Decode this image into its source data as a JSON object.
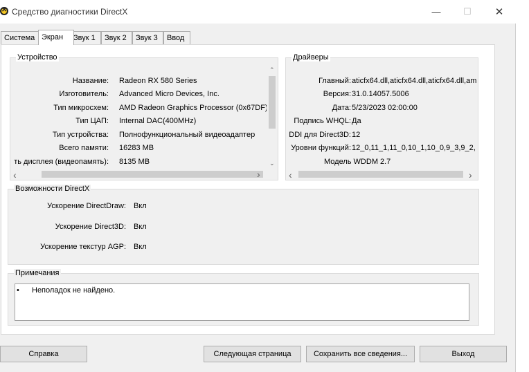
{
  "window": {
    "title": "Средство диагностики DirectX",
    "minimize": "—",
    "maximize": "☐",
    "close": "✕"
  },
  "tabs": [
    "Система",
    "Экран",
    "Звук 1",
    "Звук 2",
    "Звук 3",
    "Ввод"
  ],
  "active_tab": "Экран",
  "device": {
    "title": "Устройство",
    "rows": [
      {
        "label": "Название:",
        "value": "Radeon RX 580 Series"
      },
      {
        "label": "Изготовитель:",
        "value": "Advanced Micro Devices, Inc."
      },
      {
        "label": "Тип микросхем:",
        "value": "AMD Radeon Graphics Processor (0x67DF)"
      },
      {
        "label": "Тип ЦАП:",
        "value": "Internal DAC(400MHz)"
      },
      {
        "label": "Тип устройства:",
        "value": "Полнофункциональный видеоадаптер"
      },
      {
        "label": "Всего памяти:",
        "value": "16283 MB"
      },
      {
        "label": "ть дисплея (видеопамять):",
        "value": "8135 MB"
      }
    ]
  },
  "drivers": {
    "title": "Драйверы",
    "rows": [
      {
        "label": "Главный:",
        "value": "aticfx64.dll,aticfx64.dll,aticfx64.dll,am"
      },
      {
        "label": "Версия:",
        "value": "31.0.14057.5006"
      },
      {
        "label": "Дата:",
        "value": "5/23/2023 02:00:00"
      },
      {
        "label": "Подпись WHQL:",
        "value": "Да"
      },
      {
        "label": "DDI для Direct3D:",
        "value": "12"
      },
      {
        "label": "Уровни функций:",
        "value": "12_0,11_1,11_0,10_1,10_0,9_3,9_2,"
      },
      {
        "label": "Модель WDDM",
        "value": "2.7"
      }
    ]
  },
  "directx": {
    "title": "Возможности DirectX",
    "rows": [
      {
        "label": "Ускорение DirectDraw:",
        "value": "Вкл"
      },
      {
        "label": "Ускорение Direct3D:",
        "value": "Вкл"
      },
      {
        "label": "Ускорение текстур AGP:",
        "value": "Вкл"
      }
    ]
  },
  "notes": {
    "title": "Примечания",
    "items": [
      "Неполадок не найдено."
    ]
  },
  "buttons": {
    "help": "Справка",
    "next": "Следующая страница",
    "save": "Сохранить все сведения...",
    "exit": "Выход"
  },
  "scroll_glyphs": {
    "up": "⌃",
    "down": "⌄",
    "left": "‹",
    "right": "›"
  },
  "bullet": "•"
}
